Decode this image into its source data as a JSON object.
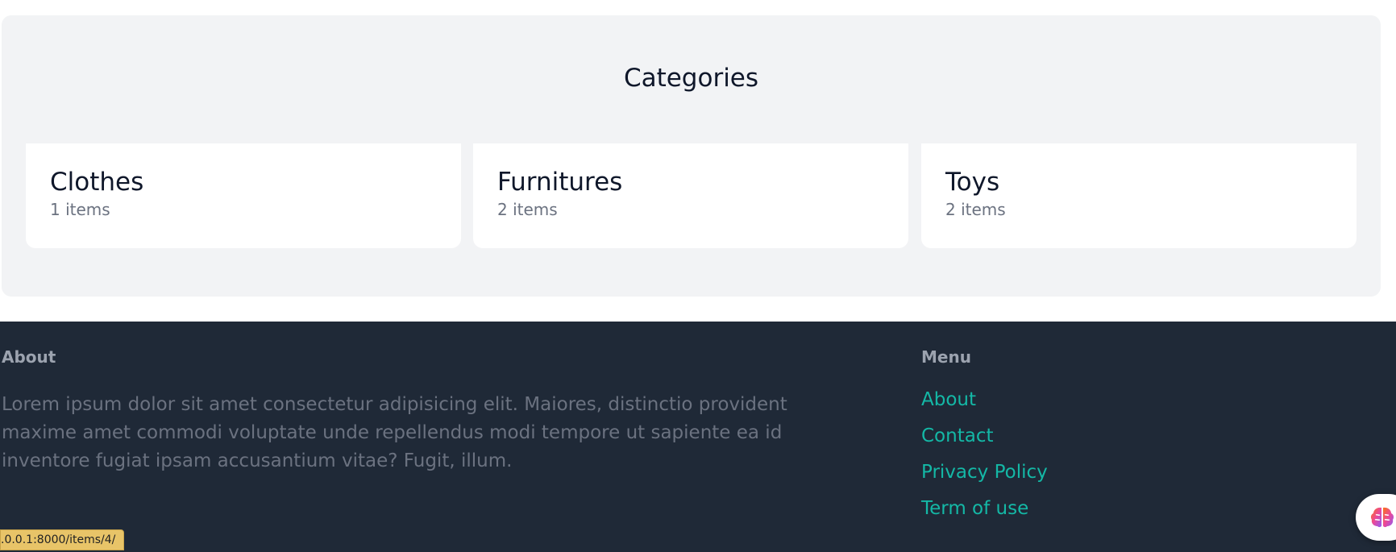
{
  "categories": {
    "title": "Categories",
    "items": [
      {
        "name": "Clothes",
        "count": "1 items"
      },
      {
        "name": "Furnitures",
        "count": "2 items"
      },
      {
        "name": "Toys",
        "count": "2 items"
      }
    ]
  },
  "footer": {
    "about_heading": "About",
    "about_text": "Lorem ipsum dolor sit amet consectetur adipisicing elit. Maiores, distinctio provident maxime amet commodi voluptate unde repellendus modi tempore ut sapiente ea id inventore fugiat ipsam accusantium vitae? Fugit, illum.",
    "menu_heading": "Menu",
    "menu_items": [
      {
        "label": "About"
      },
      {
        "label": "Contact"
      },
      {
        "label": "Privacy Policy"
      },
      {
        "label": "Term of use"
      }
    ]
  },
  "status_bar": {
    "url": ".0.0.1:8000/items/4/"
  },
  "assistant": {
    "icon": "brain-icon"
  },
  "colors": {
    "section_bg": "#f2f3f5",
    "footer_bg": "#1f2937",
    "link": "#14b8a6",
    "muted_text": "#6b7280",
    "status_bg": "#e8c468"
  }
}
